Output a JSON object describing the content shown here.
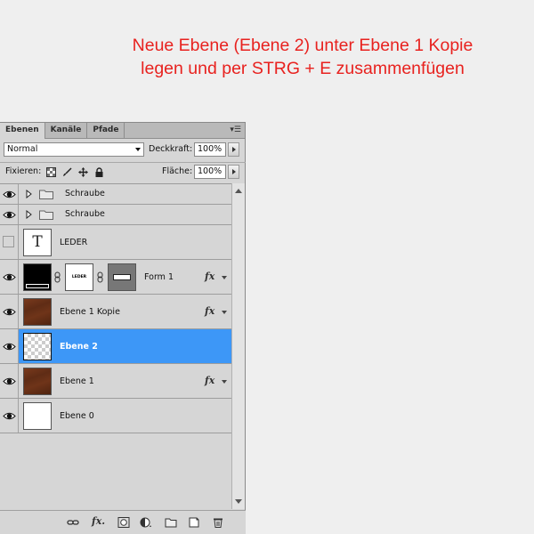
{
  "instruction": {
    "line1": "Neue Ebene (Ebene 2) unter Ebene 1 Kopie",
    "line2": "legen und per STRG + E zusammenfügen"
  },
  "tabs": [
    {
      "label": "Ebenen",
      "active": true
    },
    {
      "label": "Kanäle",
      "active": false
    },
    {
      "label": "Pfade",
      "active": false
    }
  ],
  "panel_menu_icon": "panel-menu-icon",
  "blend": {
    "mode": "Normal",
    "opacity_label": "Deckkraft:",
    "opacity_value": "100%",
    "lock_label": "Fixieren:",
    "fill_label": "Fläche:",
    "fill_value": "100%"
  },
  "layers": [
    {
      "name": "Schraube",
      "type": "group",
      "visible": true
    },
    {
      "name": "Schraube",
      "type": "group",
      "visible": true
    },
    {
      "name": "LEDER",
      "type": "text",
      "visible": false,
      "thumb_glyph": "T"
    },
    {
      "name": "Form 1",
      "type": "shape",
      "visible": true,
      "mask_text": "LEDER",
      "fx": "fx"
    },
    {
      "name": "Ebene 1 Kopie",
      "type": "pixel",
      "visible": true,
      "fx": "fx"
    },
    {
      "name": "Ebene 2",
      "type": "pixel",
      "visible": true,
      "selected": true
    },
    {
      "name": "Ebene 1",
      "type": "pixel",
      "visible": true,
      "fx": "fx"
    },
    {
      "name": "Ebene 0",
      "type": "pixel",
      "visible": true
    }
  ],
  "bottom_icons": [
    "link-icon",
    "fx-icon",
    "mask-icon",
    "adjustment-icon",
    "folder-icon",
    "new-layer-icon",
    "trash-icon"
  ],
  "colors": {
    "instruction": "#e8221f",
    "selection": "#3d97f7",
    "panel": "#d6d6d6"
  }
}
